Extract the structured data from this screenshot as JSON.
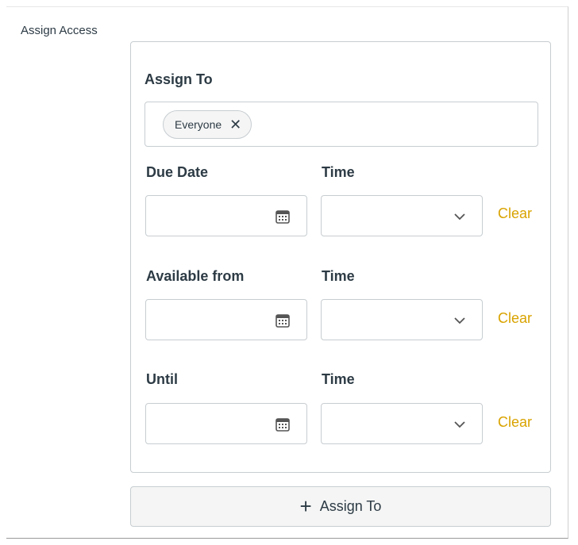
{
  "section_label": "Assign Access",
  "assign_to": {
    "label": "Assign To",
    "chips": [
      {
        "label": "Everyone",
        "remove_icon": "close-icon"
      }
    ]
  },
  "rows": [
    {
      "date_label": "Due Date",
      "time_label": "Time",
      "date_value": "",
      "time_value": "",
      "clear_label": "Clear"
    },
    {
      "date_label": "Available from",
      "time_label": "Time",
      "date_value": "",
      "time_value": "",
      "clear_label": "Clear"
    },
    {
      "date_label": "Until",
      "time_label": "Time",
      "date_value": "",
      "time_value": "",
      "clear_label": "Clear"
    }
  ],
  "add_button": {
    "label": "Assign To",
    "icon": "plus-icon"
  },
  "colors": {
    "accent": "#d9a300",
    "text": "#2d3b45",
    "border": "#c7cdd1",
    "button_bg": "#f5f5f5"
  }
}
